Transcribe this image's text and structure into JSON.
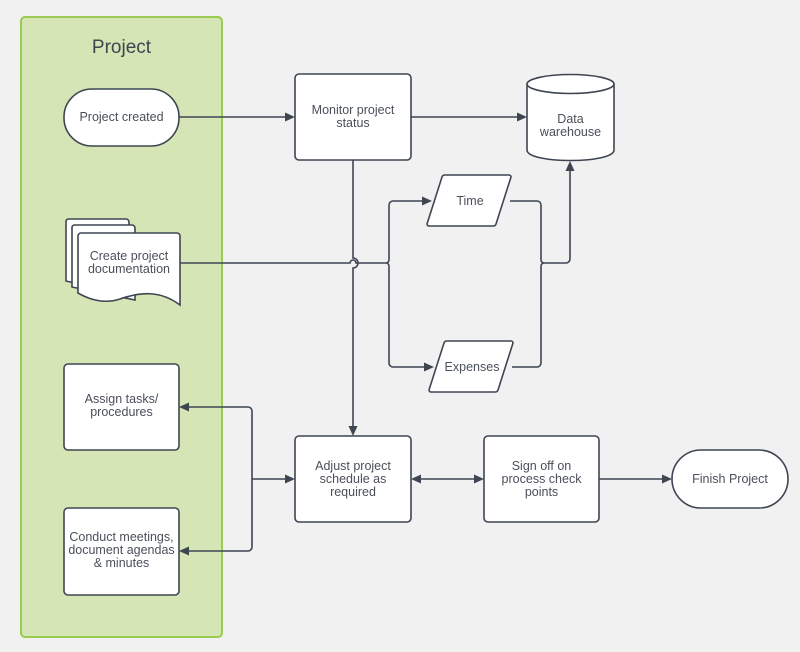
{
  "diagram": {
    "swimlane": {
      "title": "Project",
      "fill": "#d5e5b5",
      "border": "#9acb50"
    },
    "nodes": {
      "project_created": {
        "label": "Project created",
        "shape": "terminator"
      },
      "create_docs": {
        "label": "Create project documentation",
        "shape": "multi-document"
      },
      "assign_tasks": {
        "label": "Assign tasks/ procedures",
        "shape": "process"
      },
      "conduct_meetings": {
        "label": "Conduct meetings, document agendas & minutes",
        "shape": "process"
      },
      "monitor_status": {
        "label": "Monitor project status",
        "shape": "process"
      },
      "data_warehouse": {
        "label": "Data warehouse",
        "shape": "database"
      },
      "time": {
        "label": "Time",
        "shape": "data"
      },
      "expenses": {
        "label": "Expenses",
        "shape": "data"
      },
      "adjust_schedule": {
        "label": "Adjust project schedule as required",
        "shape": "process"
      },
      "sign_off": {
        "label": "Sign off on process check points",
        "shape": "process"
      },
      "finish_project": {
        "label": "Finish Project",
        "shape": "terminator"
      }
    },
    "edges": [
      {
        "from": "project_created",
        "to": "monitor_status"
      },
      {
        "from": "monitor_status",
        "to": "data_warehouse"
      },
      {
        "from": "monitor_status",
        "to": "adjust_schedule"
      },
      {
        "from": "create_docs",
        "to": "time"
      },
      {
        "from": "create_docs",
        "to": "expenses"
      },
      {
        "from": "time",
        "to": "data_warehouse"
      },
      {
        "from": "expenses",
        "to": "data_warehouse"
      },
      {
        "from": "adjust_schedule",
        "to": "assign_tasks"
      },
      {
        "from": "adjust_schedule",
        "to": "conduct_meetings"
      },
      {
        "from": "assign_tasks",
        "to": "adjust_schedule"
      },
      {
        "from": "adjust_schedule",
        "to": "sign_off",
        "bidirectional": true
      },
      {
        "from": "sign_off",
        "to": "finish_project"
      }
    ],
    "colors": {
      "stroke": "#3e4652",
      "background": "#f1f1f1",
      "node_fill": "#ffffff",
      "text": "#4a505a"
    }
  }
}
